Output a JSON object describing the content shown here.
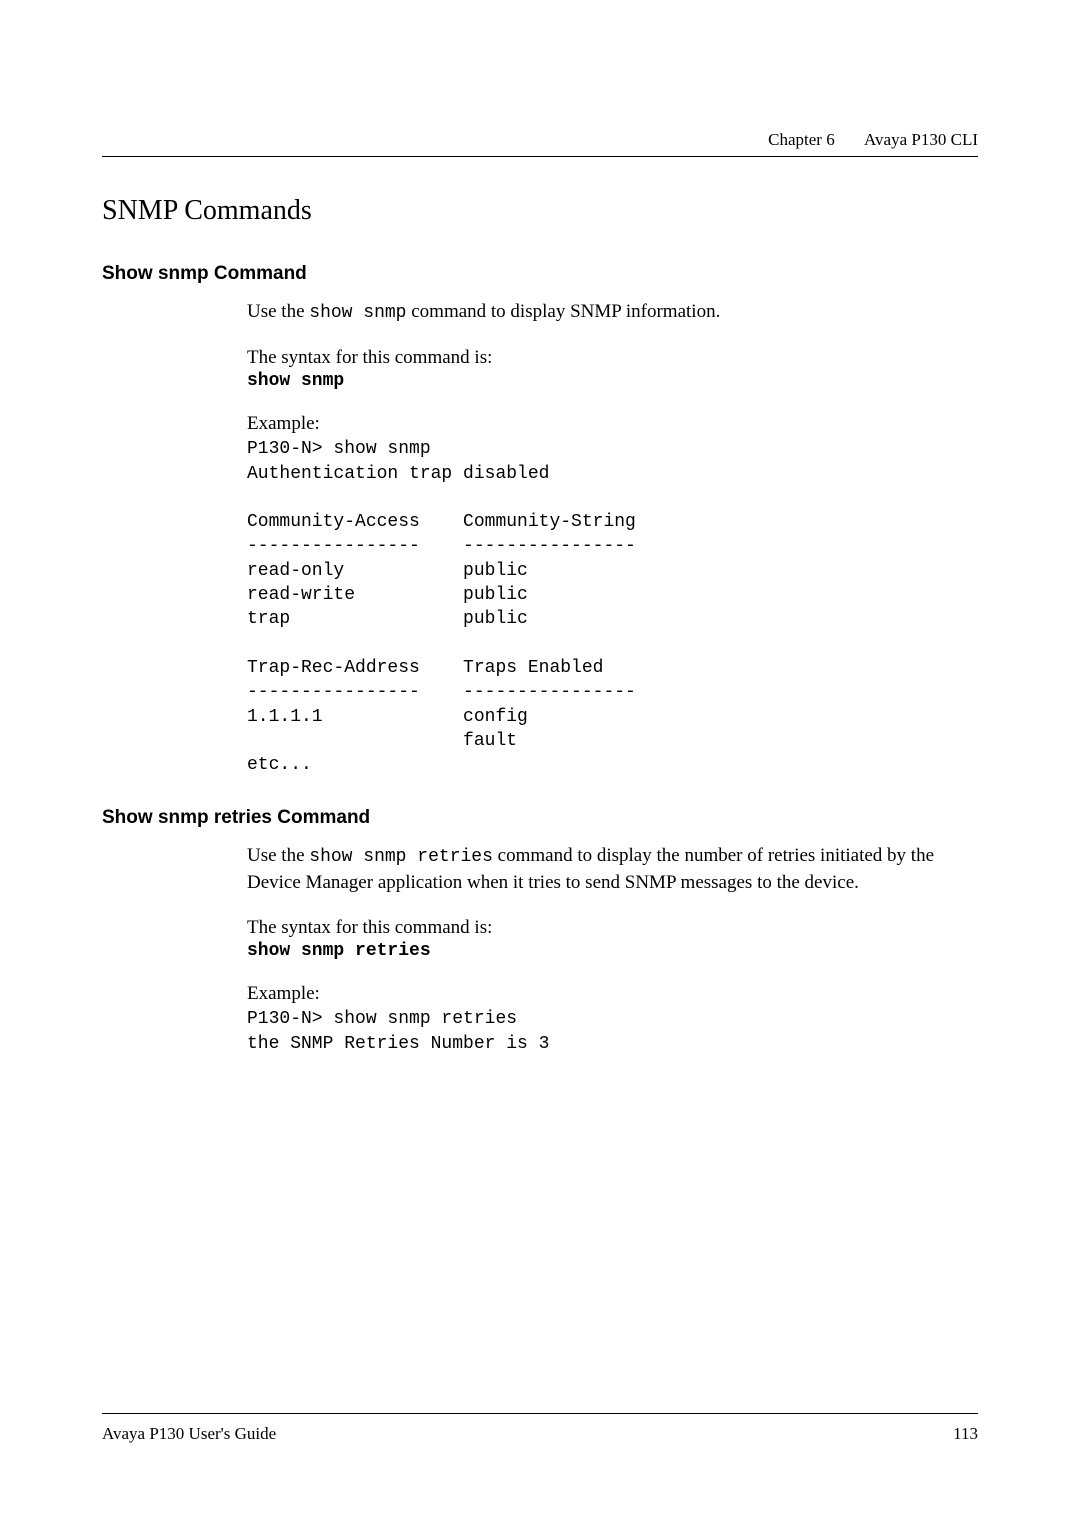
{
  "header": {
    "chapter": "Chapter 6",
    "title": "Avaya P130 CLI"
  },
  "section": {
    "title": "SNMP Commands"
  },
  "sub1": {
    "title": "Show snmp Command",
    "desc_pre": "Use the ",
    "desc_mono": "show snmp",
    "desc_post": " command to display SNMP information.",
    "syntax_label": "The syntax for this command is:",
    "syntax_cmd": "show snmp",
    "example_label": "Example:",
    "example_code": "P130-N> show snmp\nAuthentication trap disabled\n\nCommunity-Access    Community-String\n----------------    ----------------\nread-only           public\nread-write          public\ntrap                public\n\nTrap-Rec-Address    Traps Enabled\n----------------    ----------------\n1.1.1.1             config\n                    fault\netc..."
  },
  "sub2": {
    "title": "Show snmp retries Command",
    "desc_pre": "Use the ",
    "desc_mono": "show snmp retries",
    "desc_post": " command to display the number of retries initiated by the Device Manager application when it tries to send SNMP messages to the device.",
    "syntax_label": "The syntax for this command is:",
    "syntax_cmd": "show snmp retries",
    "example_label": "Example:",
    "example_code": "P130-N> show snmp retries\nthe SNMP Retries Number is 3"
  },
  "footer": {
    "left": "Avaya P130 User's Guide",
    "right": "113"
  }
}
